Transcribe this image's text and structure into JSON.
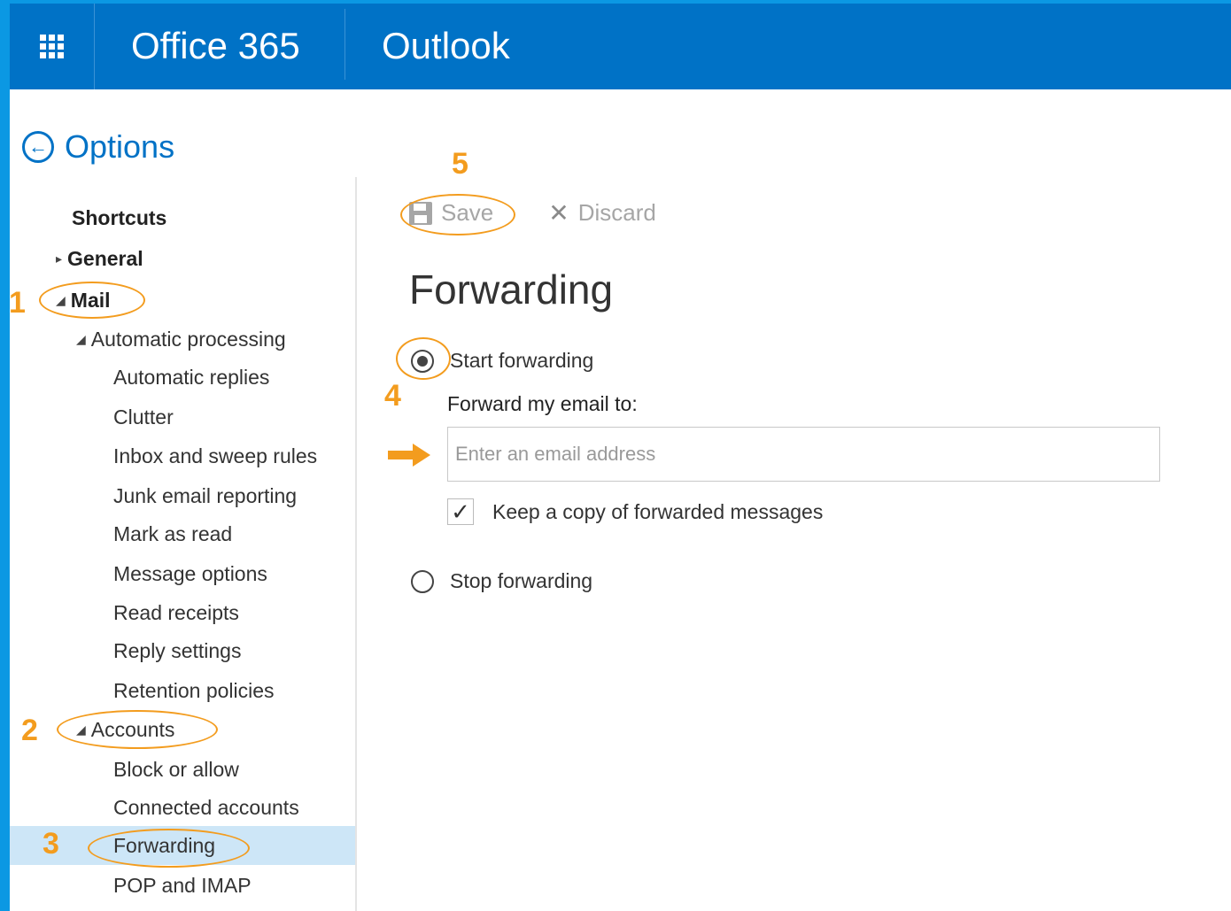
{
  "topbar": {
    "brand": "Office 365",
    "app": "Outlook",
    "waffle_icon": "app-launcher-icon"
  },
  "options": {
    "title": "Options",
    "icon": "back-arrow-circle-icon"
  },
  "sidebar": {
    "shortcuts": "Shortcuts",
    "general": "General",
    "mail": "Mail",
    "automatic_processing": "Automatic processing",
    "auto_items": [
      "Automatic replies",
      "Clutter",
      "Inbox and sweep rules",
      "Junk email reporting",
      "Mark as read",
      "Message options",
      "Read receipts",
      "Reply settings",
      "Retention policies"
    ],
    "accounts": "Accounts",
    "account_items": [
      "Block or allow",
      "Connected accounts",
      "Forwarding",
      "POP and IMAP"
    ],
    "selected": "Forwarding"
  },
  "toolbar": {
    "save": "Save",
    "discard": "Discard"
  },
  "main": {
    "title": "Forwarding",
    "start_forwarding": "Start forwarding",
    "start_selected": true,
    "forward_label": "Forward my email to:",
    "email_value": "",
    "email_placeholder": "Enter an email address",
    "keep_copy": "Keep a copy of forwarded messages",
    "keep_copy_checked": true,
    "stop_forwarding": "Stop forwarding"
  },
  "annotations": {
    "color": "#f39c1e",
    "steps": [
      "1",
      "2",
      "3",
      "4",
      "5"
    ]
  },
  "colors": {
    "topbar": "#0072c6",
    "frame": "#0b98e3",
    "selected_bg": "#cde6f7",
    "link": "#0072c6"
  }
}
